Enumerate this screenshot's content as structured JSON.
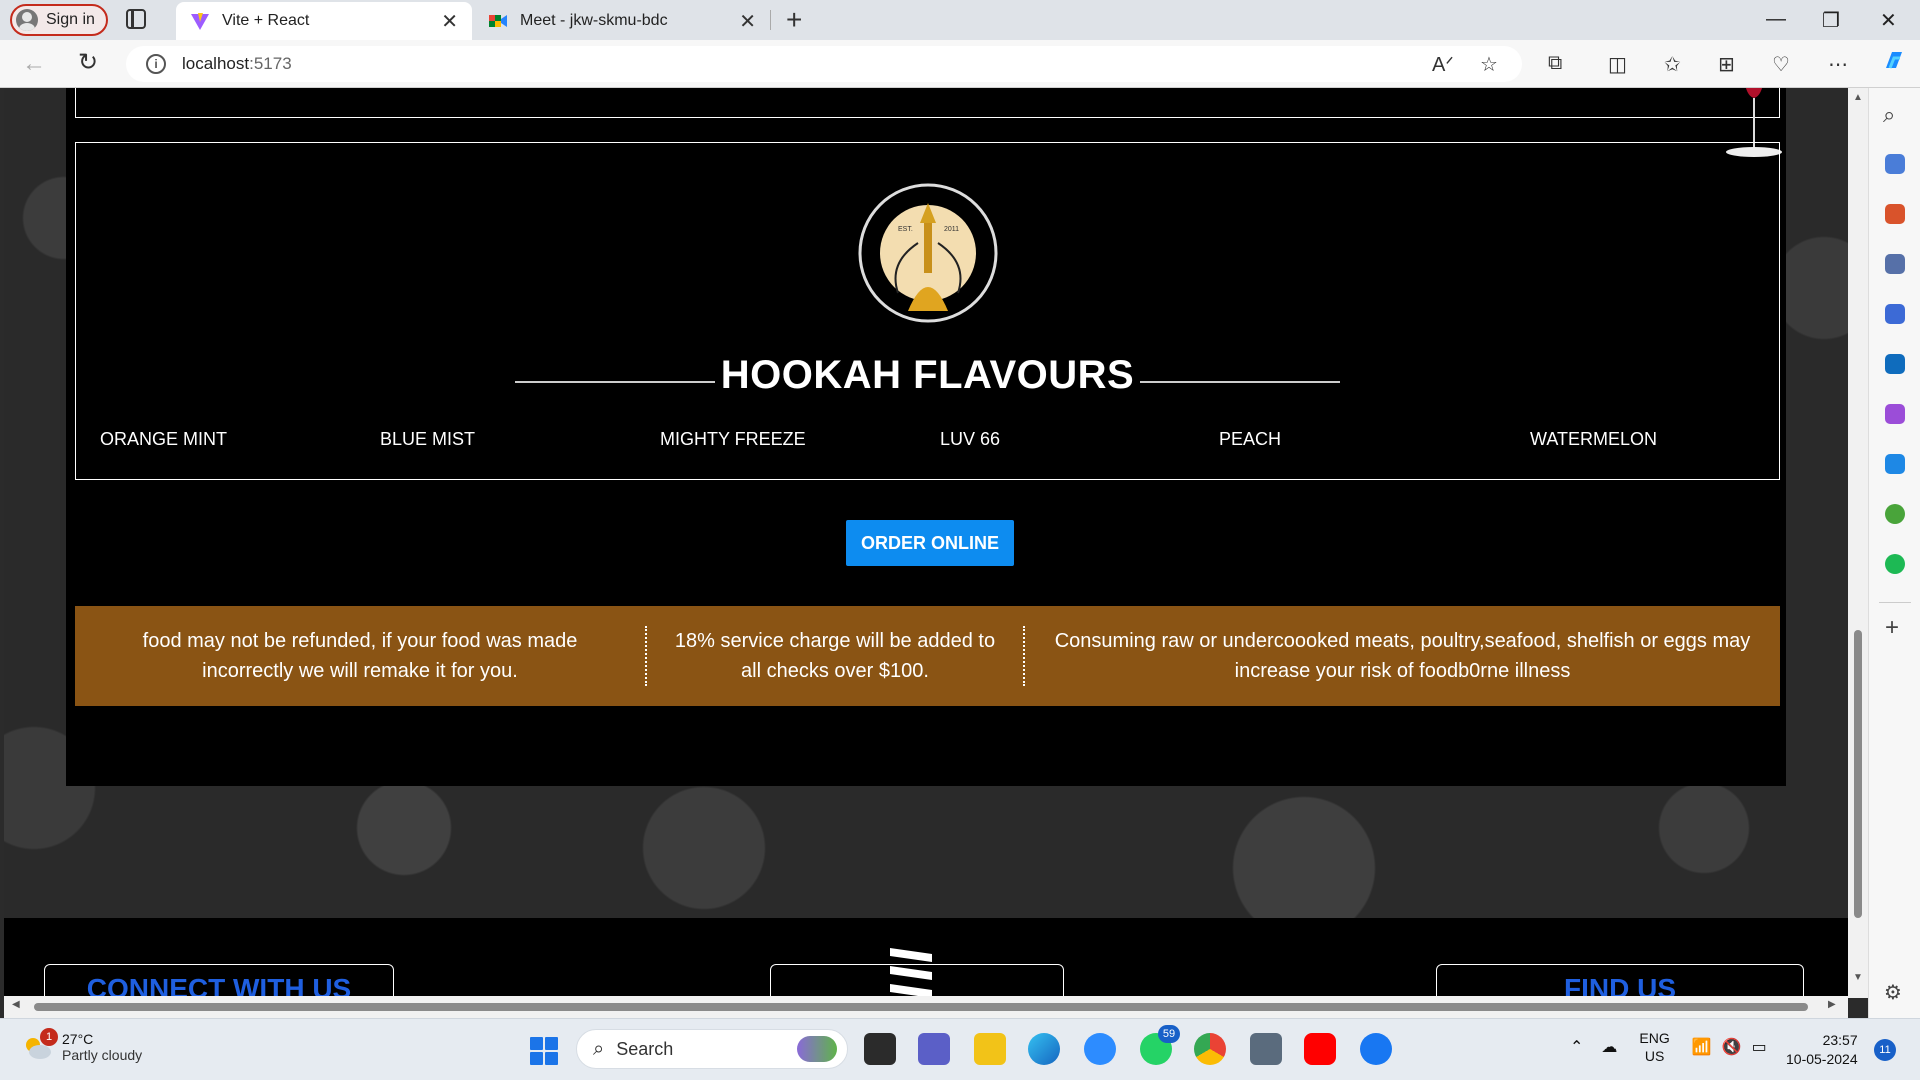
{
  "browser": {
    "signin_label": "Sign in",
    "tabs": [
      {
        "title": "Vite + React",
        "active": true
      },
      {
        "title": "Meet - jkw-skmu-bdc",
        "active": false
      }
    ],
    "url_host": "localhost",
    "url_port": ":5173"
  },
  "page": {
    "flavours_title": "HOOKAH FLAVOURS",
    "logo_text": {
      "top": "HOOKAH LOUNGE",
      "est": "EST.",
      "year": "2011"
    },
    "flavours": [
      "ORANGE MINT",
      "BLUE MIST",
      "MIGHTY FREEZE",
      "LUV 66",
      "PEACH",
      "WATERMELON"
    ],
    "order_button": "ORDER ONLINE",
    "notices": [
      "food may not be refunded, if your food was made incorrectly we will remake it for you.",
      "18% service charge will be added to all checks over $100.",
      "Consuming raw or undercoooked meats, poultry,seafood, shelfish or eggs may increase your risk of foodb0rne illness"
    ],
    "footer": {
      "connect_label": "CONNECT WITH US",
      "find_label": "FIND US"
    }
  },
  "taskbar": {
    "weather_temp": "27°C",
    "weather_desc": "Partly cloudy",
    "weather_badge": "1",
    "search_placeholder": "Search",
    "whatsapp_count": "59",
    "lang1": "ENG",
    "lang2": "US",
    "time": "23:57",
    "date": "10-05-2024",
    "notif_count": "11"
  },
  "colors": {
    "accent_blue": "#0d8cf0",
    "notice_brown": "#8a5414",
    "page_black": "#000000"
  }
}
